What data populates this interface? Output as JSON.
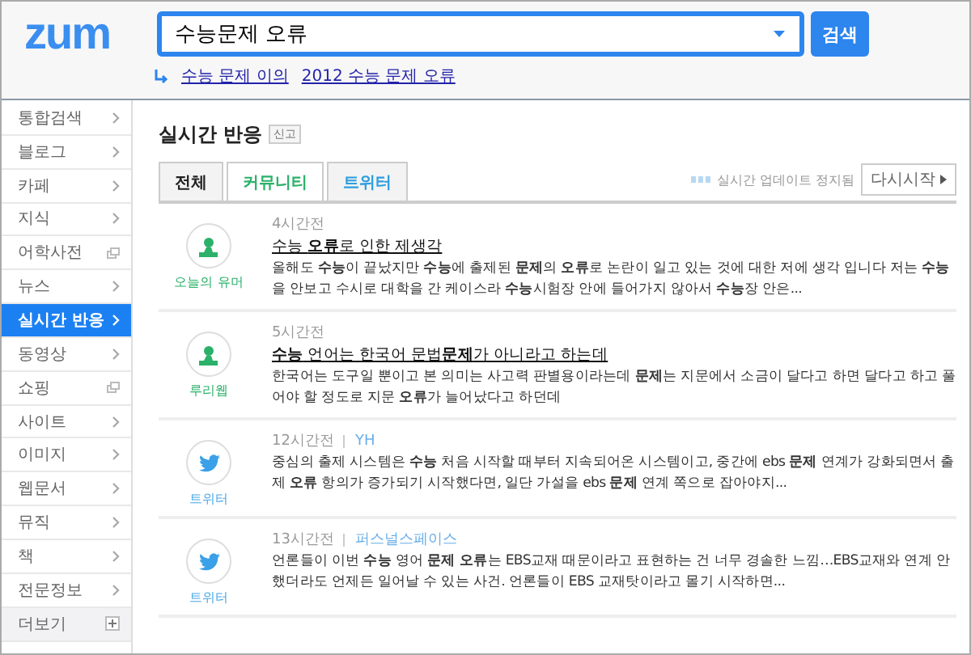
{
  "header": {
    "logo": "zum",
    "search": {
      "value": "수능문제 오류"
    },
    "search_button": "검색",
    "related": [
      "수능 문제 이의",
      "2012 수능 문제 오류"
    ]
  },
  "sidebar": {
    "items": [
      {
        "label": "통합검색",
        "kind": "arrow",
        "selected": false
      },
      {
        "label": "블로그",
        "kind": "arrow",
        "selected": false
      },
      {
        "label": "카페",
        "kind": "arrow",
        "selected": false
      },
      {
        "label": "지식",
        "kind": "arrow",
        "selected": false
      },
      {
        "label": "어학사전",
        "kind": "external",
        "selected": false
      },
      {
        "label": "뉴스",
        "kind": "arrow",
        "selected": false
      },
      {
        "label": "실시간 반응",
        "kind": "arrow",
        "selected": true
      },
      {
        "label": "동영상",
        "kind": "arrow",
        "selected": false
      },
      {
        "label": "쇼핑",
        "kind": "external",
        "selected": false
      },
      {
        "label": "사이트",
        "kind": "arrow",
        "selected": false
      },
      {
        "label": "이미지",
        "kind": "arrow",
        "selected": false
      },
      {
        "label": "웹문서",
        "kind": "arrow",
        "selected": false
      },
      {
        "label": "뮤직",
        "kind": "arrow",
        "selected": false
      },
      {
        "label": "책",
        "kind": "arrow",
        "selected": false
      },
      {
        "label": "전문정보",
        "kind": "arrow",
        "selected": false
      },
      {
        "label": "더보기",
        "kind": "more",
        "selected": false
      }
    ]
  },
  "section": {
    "title": "실시간 반응",
    "badge": "신고",
    "status": "실시간 업데이트 정지됨",
    "restart_button": "다시시작"
  },
  "tabs": [
    {
      "label": "전체",
      "selected": false,
      "kind": "all"
    },
    {
      "label": "커뮤니티",
      "selected": true,
      "kind": "community"
    },
    {
      "label": "트위터",
      "selected": false,
      "kind": "twitter"
    }
  ],
  "posts": [
    {
      "kind": "community",
      "author": "오늘의 유머",
      "time": "4시간전",
      "title": "수능 **오류**로 인한 제생각",
      "body": "올해도 **수능**이 끝났지만 **수능**에 출제된 **문제**의 **오류**로 논란이 일고 있는 것에 대한 저에 생각 입니다 저는 **수능**을 안보고 수시로 대학을 간 케이스라 **수능**시험장 안에 들어가지 않아서 **수능**장 안은..."
    },
    {
      "kind": "community",
      "author": "루리웹",
      "time": "5시간전",
      "title": "**수능** 언어는 한국어 문법**문제**가 아니라고 하는데",
      "body": "한국어는 도구일 뿐이고 본 의미는 사고력 판별용이라는데 **문제**는 지문에서 소금이 달다고 하면 달다고 하고 풀어야 할 정도로 지문 **오류**가 늘어났다고 하던데"
    },
    {
      "kind": "twitter",
      "author": "트위터",
      "time": "12시간전",
      "source": "YH",
      "body": "중심의 출제 시스템은 **수능** 처음 시작할 때부터 지속되어온 시스템이고, 중간에 ebs **문제** 연계가 강화되면서 출제 **오류** 항의가 증가되기 시작했다면, 일단 가설을 ebs **문제** 연계 쪽으로 잡아야지..."
    },
    {
      "kind": "twitter",
      "author": "트위터",
      "time": "13시간전",
      "source": "퍼스널스페이스",
      "body": "언론들이 이번 **수능** 영어 **문제 오류**는 EBS교재 때문이라고 표현하는 건 너무 경솔한 느낌…EBS교재와 연계 안 했더라도 언제든 일어날 수 있는 사건. 언론들이 EBS 교재탓이라고 몰기 시작하면..."
    }
  ]
}
